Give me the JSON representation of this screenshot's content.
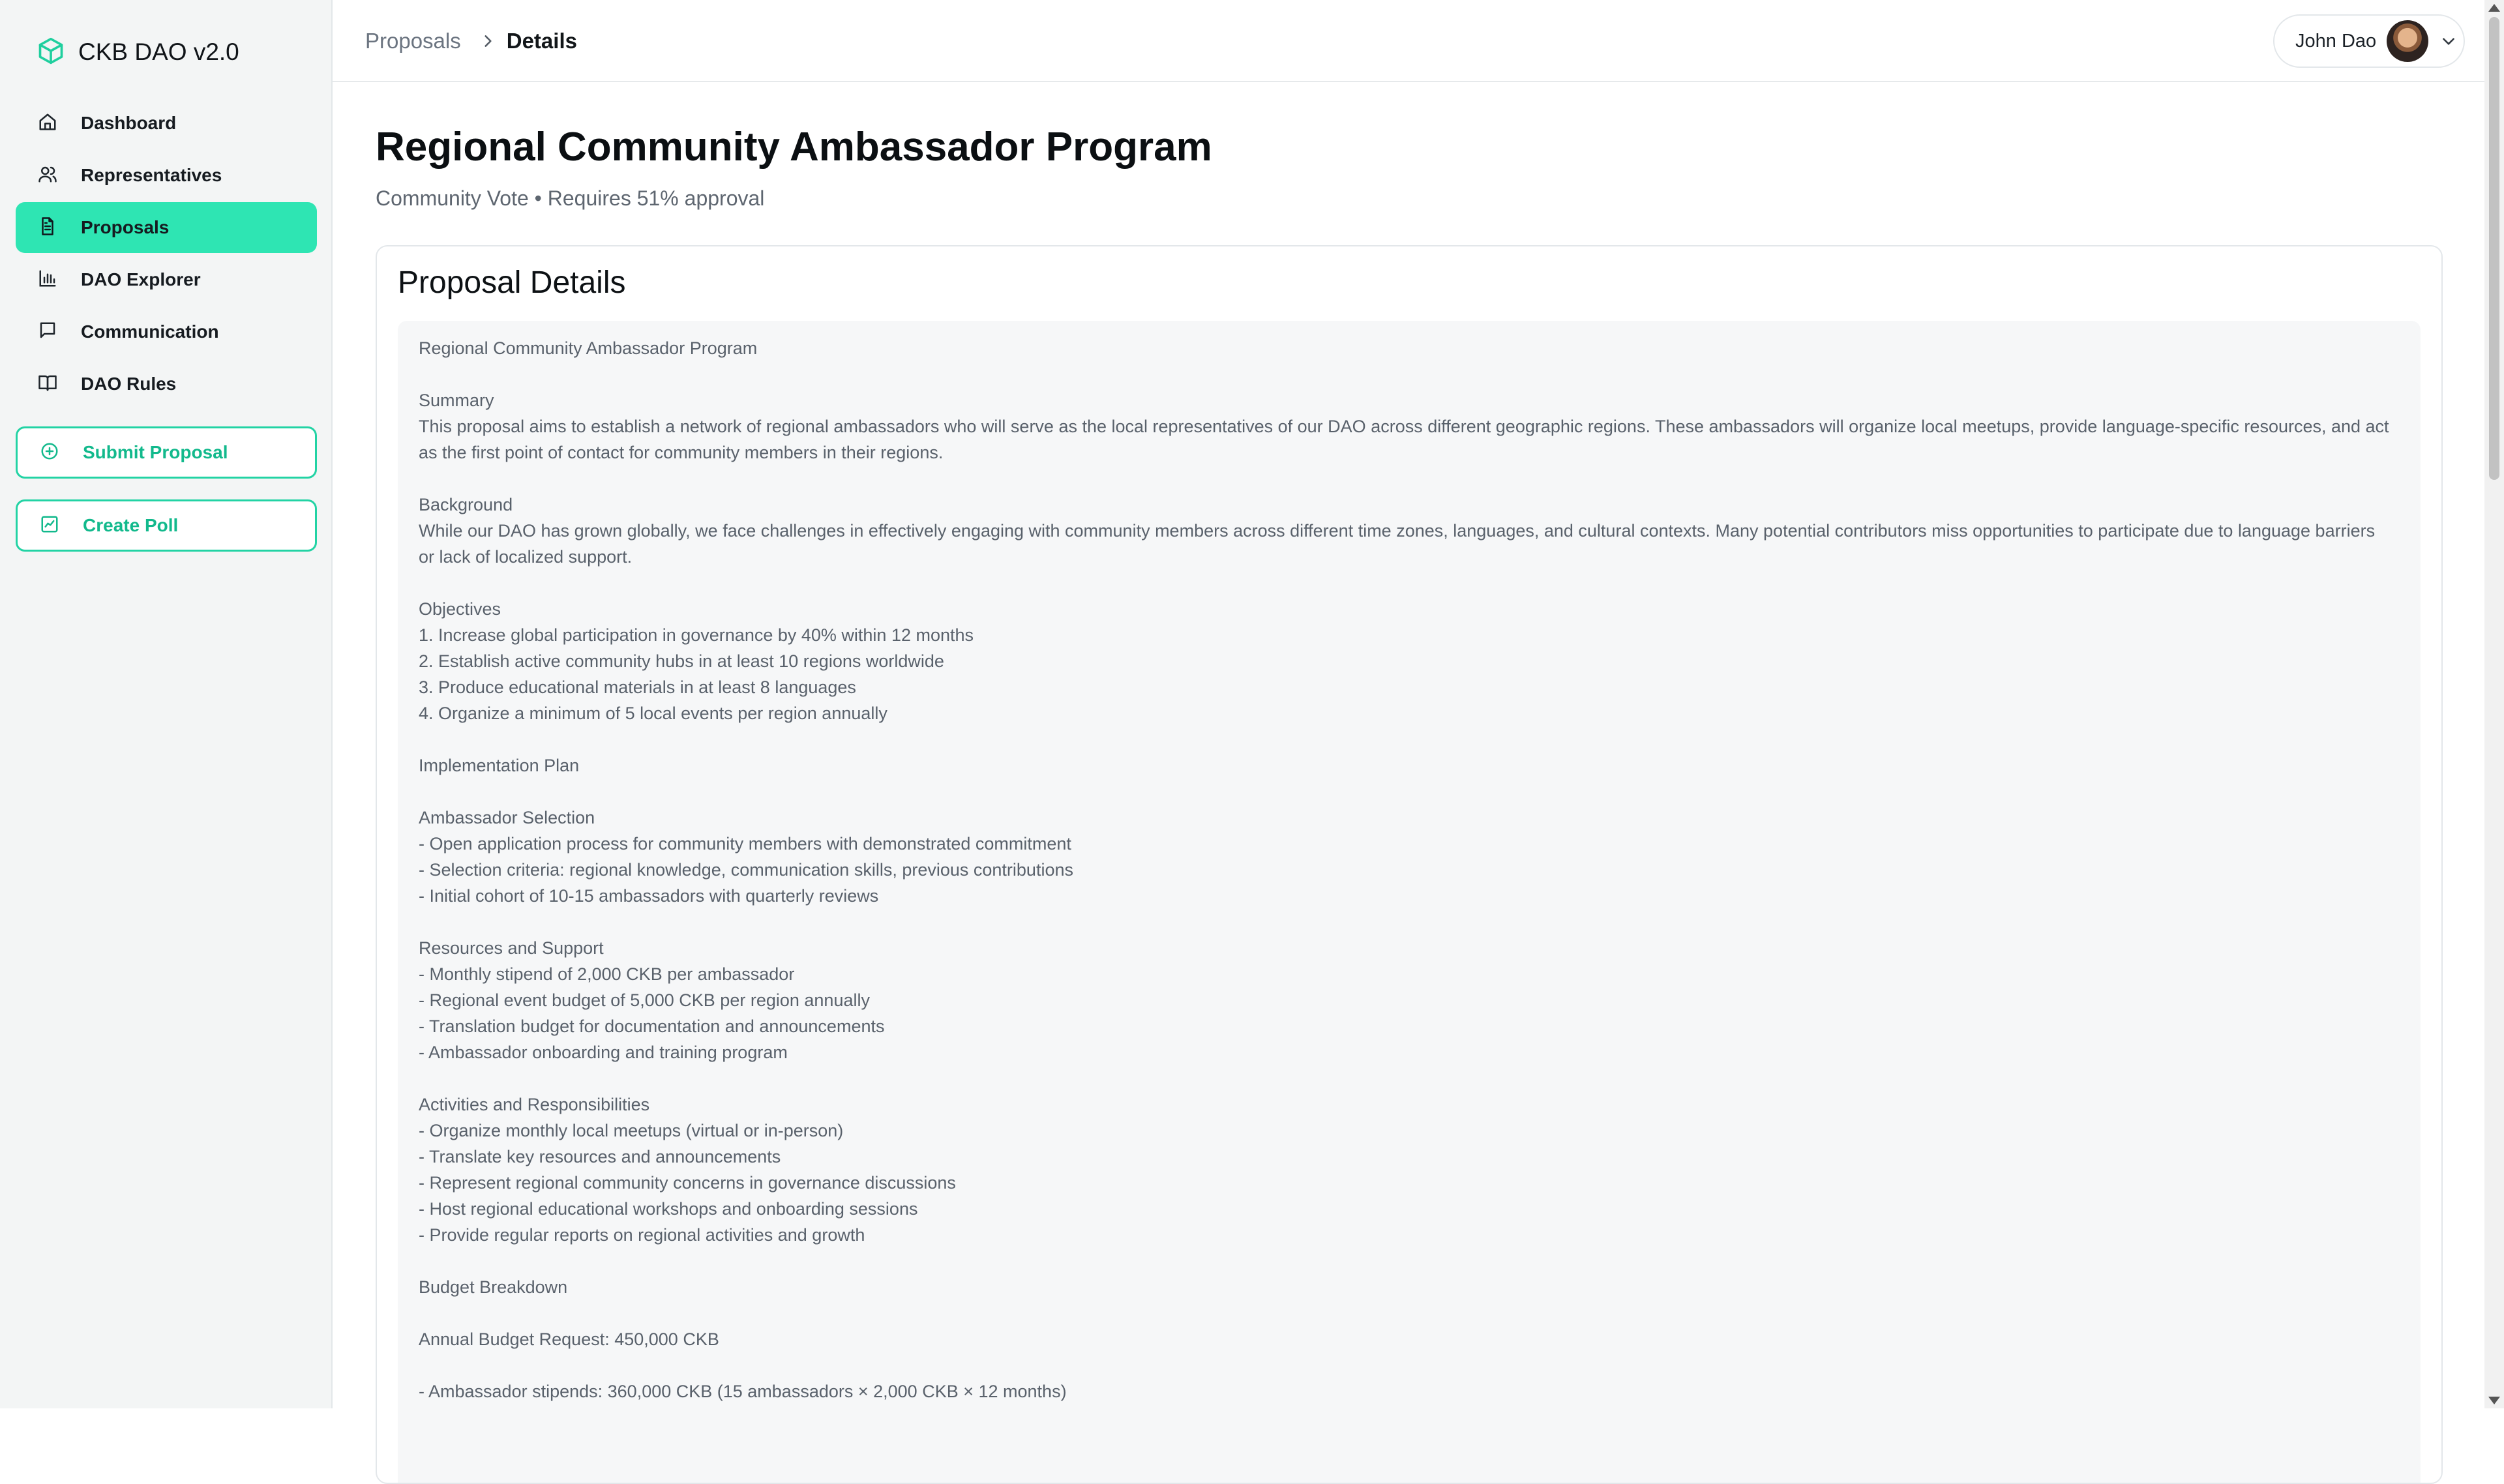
{
  "brand": {
    "name": "CKB DAO v2.0",
    "accent": "#2ee5b3"
  },
  "nav": [
    {
      "label": "Dashboard",
      "icon": "home-icon",
      "active": false
    },
    {
      "label": "Representatives",
      "icon": "users-icon",
      "active": false
    },
    {
      "label": "Proposals",
      "icon": "file-text-icon",
      "active": true
    },
    {
      "label": "DAO Explorer",
      "icon": "bar-chart-icon",
      "active": false
    },
    {
      "label": "Communication",
      "icon": "message-square-icon",
      "active": false
    },
    {
      "label": "DAO Rules",
      "icon": "book-open-icon",
      "active": false
    }
  ],
  "actions": {
    "submit_proposal": "Submit Proposal",
    "create_poll": "Create Poll"
  },
  "breadcrumb": {
    "parent": "Proposals",
    "current": "Details"
  },
  "user": {
    "name": "John Dao"
  },
  "proposal": {
    "title": "Regional Community Ambassador Program",
    "subtitle": "Community Vote • Requires 51% approval",
    "card_title": "Proposal Details",
    "body": "Regional Community Ambassador Program\n\nSummary\nThis proposal aims to establish a network of regional ambassadors who will serve as the local representatives of our DAO across different geographic regions. These ambassadors will organize local meetups, provide language-specific resources, and act as the first point of contact for community members in their regions.\n\nBackground\nWhile our DAO has grown globally, we face challenges in effectively engaging with community members across different time zones, languages, and cultural contexts. Many potential contributors miss opportunities to participate due to language barriers or lack of localized support.\n\nObjectives\n1. Increase global participation in governance by 40% within 12 months\n2. Establish active community hubs in at least 10 regions worldwide\n3. Produce educational materials in at least 8 languages\n4. Organize a minimum of 5 local events per region annually\n\nImplementation Plan\n\nAmbassador Selection\n- Open application process for community members with demonstrated commitment\n- Selection criteria: regional knowledge, communication skills, previous contributions\n- Initial cohort of 10-15 ambassadors with quarterly reviews\n\nResources and Support\n- Monthly stipend of 2,000 CKB per ambassador\n- Regional event budget of 5,000 CKB per region annually\n- Translation budget for documentation and announcements\n- Ambassador onboarding and training program\n\nActivities and Responsibilities\n- Organize monthly local meetups (virtual or in-person)\n- Translate key resources and announcements\n- Represent regional community concerns in governance discussions\n- Host regional educational workshops and onboarding sessions\n- Provide regular reports on regional activities and growth\n\nBudget Breakdown\n\nAnnual Budget Request: 450,000 CKB\n\n- Ambassador stipends: 360,000 CKB (15 ambassadors × 2,000 CKB × 12 months)"
  }
}
